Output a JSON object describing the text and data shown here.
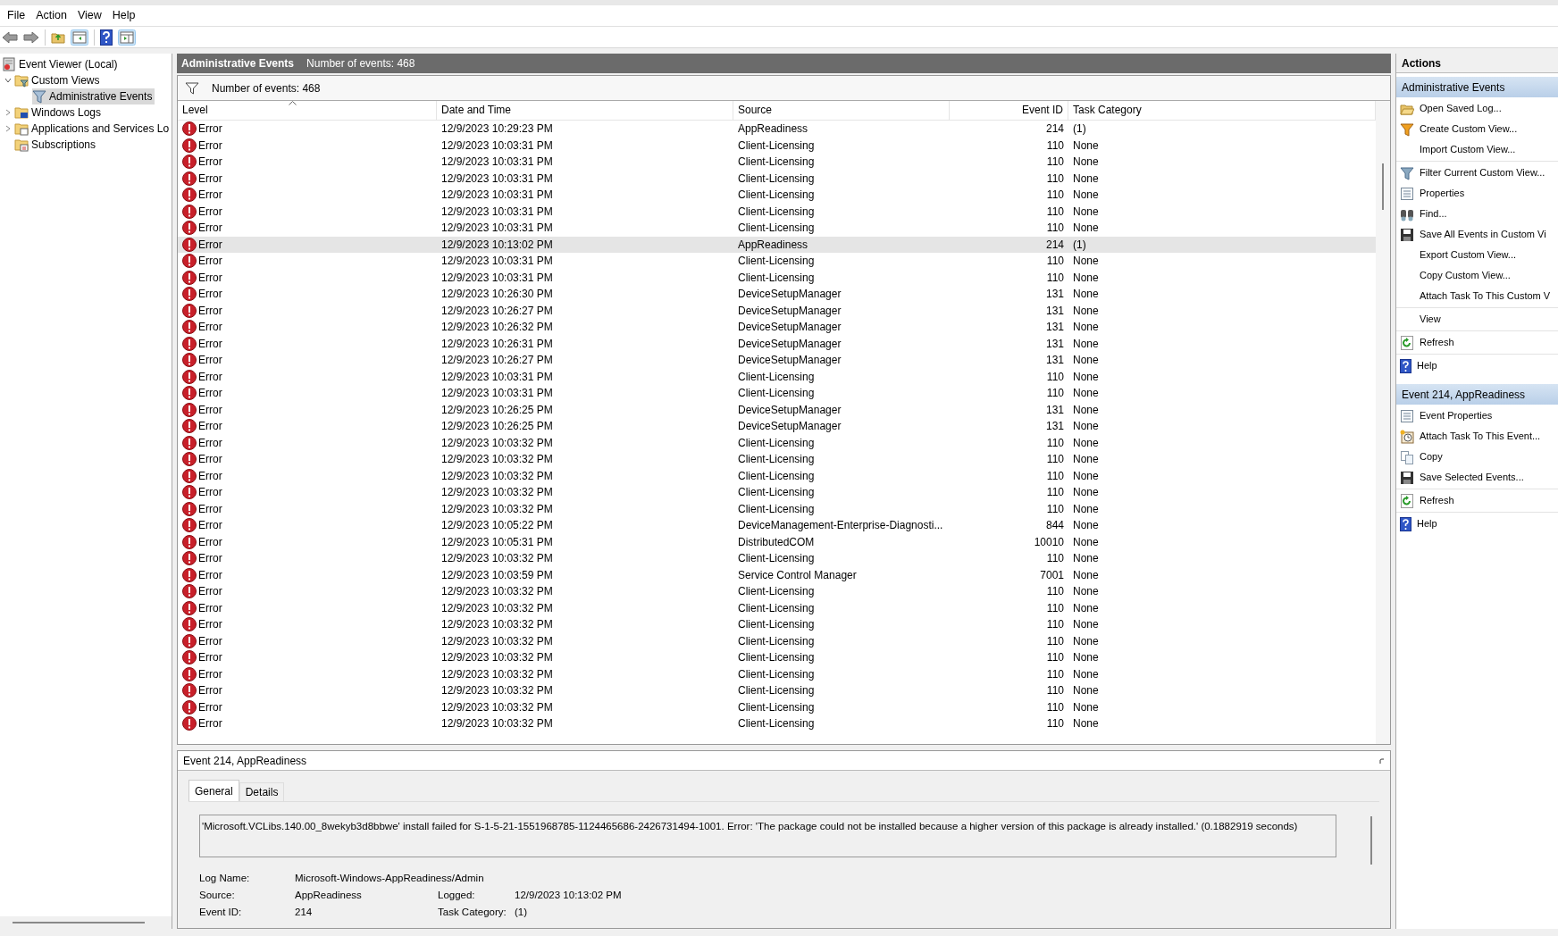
{
  "menu": [
    "File",
    "Action",
    "View",
    "Help"
  ],
  "tree": [
    {
      "label": "Event Viewer (Local)",
      "kind": "root",
      "selected": false,
      "children": [
        {
          "label": "Custom Views",
          "kind": "folder-filter",
          "expanded": true,
          "selected": false,
          "children": [
            {
              "label": "Administrative Events",
              "kind": "filter",
              "selected": true
            }
          ]
        },
        {
          "label": "Windows Logs",
          "kind": "folder-log",
          "expanded": false,
          "selected": false
        },
        {
          "label": "Applications and Services Lo",
          "kind": "folder-app",
          "expanded": false,
          "selected": false
        },
        {
          "label": "Subscriptions",
          "kind": "folder-sub",
          "selected": false
        }
      ]
    }
  ],
  "center": {
    "title": "Administrative Events",
    "count": "Number of events: 468",
    "filter_text": "Number of events: 468"
  },
  "table": {
    "columns": [
      "Level",
      "Date and Time",
      "Source",
      "Event ID",
      "Task Category"
    ],
    "rows": [
      {
        "level": "Error",
        "time": "12/9/2023 10:29:23 PM",
        "source": "AppReadiness",
        "id": "214",
        "category": "(1)",
        "selected": false
      },
      {
        "level": "Error",
        "time": "12/9/2023 10:03:31 PM",
        "source": "Client-Licensing",
        "id": "110",
        "category": "None",
        "selected": false
      },
      {
        "level": "Error",
        "time": "12/9/2023 10:03:31 PM",
        "source": "Client-Licensing",
        "id": "110",
        "category": "None",
        "selected": false
      },
      {
        "level": "Error",
        "time": "12/9/2023 10:03:31 PM",
        "source": "Client-Licensing",
        "id": "110",
        "category": "None",
        "selected": false
      },
      {
        "level": "Error",
        "time": "12/9/2023 10:03:31 PM",
        "source": "Client-Licensing",
        "id": "110",
        "category": "None",
        "selected": false
      },
      {
        "level": "Error",
        "time": "12/9/2023 10:03:31 PM",
        "source": "Client-Licensing",
        "id": "110",
        "category": "None",
        "selected": false
      },
      {
        "level": "Error",
        "time": "12/9/2023 10:03:31 PM",
        "source": "Client-Licensing",
        "id": "110",
        "category": "None",
        "selected": false
      },
      {
        "level": "Error",
        "time": "12/9/2023 10:13:02 PM",
        "source": "AppReadiness",
        "id": "214",
        "category": "(1)",
        "selected": true
      },
      {
        "level": "Error",
        "time": "12/9/2023 10:03:31 PM",
        "source": "Client-Licensing",
        "id": "110",
        "category": "None",
        "selected": false
      },
      {
        "level": "Error",
        "time": "12/9/2023 10:03:31 PM",
        "source": "Client-Licensing",
        "id": "110",
        "category": "None",
        "selected": false
      },
      {
        "level": "Error",
        "time": "12/9/2023 10:26:30 PM",
        "source": "DeviceSetupManager",
        "id": "131",
        "category": "None",
        "selected": false
      },
      {
        "level": "Error",
        "time": "12/9/2023 10:26:27 PM",
        "source": "DeviceSetupManager",
        "id": "131",
        "category": "None",
        "selected": false
      },
      {
        "level": "Error",
        "time": "12/9/2023 10:26:32 PM",
        "source": "DeviceSetupManager",
        "id": "131",
        "category": "None",
        "selected": false
      },
      {
        "level": "Error",
        "time": "12/9/2023 10:26:31 PM",
        "source": "DeviceSetupManager",
        "id": "131",
        "category": "None",
        "selected": false
      },
      {
        "level": "Error",
        "time": "12/9/2023 10:26:27 PM",
        "source": "DeviceSetupManager",
        "id": "131",
        "category": "None",
        "selected": false
      },
      {
        "level": "Error",
        "time": "12/9/2023 10:03:31 PM",
        "source": "Client-Licensing",
        "id": "110",
        "category": "None",
        "selected": false
      },
      {
        "level": "Error",
        "time": "12/9/2023 10:03:31 PM",
        "source": "Client-Licensing",
        "id": "110",
        "category": "None",
        "selected": false
      },
      {
        "level": "Error",
        "time": "12/9/2023 10:26:25 PM",
        "source": "DeviceSetupManager",
        "id": "131",
        "category": "None",
        "selected": false
      },
      {
        "level": "Error",
        "time": "12/9/2023 10:26:25 PM",
        "source": "DeviceSetupManager",
        "id": "131",
        "category": "None",
        "selected": false
      },
      {
        "level": "Error",
        "time": "12/9/2023 10:03:32 PM",
        "source": "Client-Licensing",
        "id": "110",
        "category": "None",
        "selected": false
      },
      {
        "level": "Error",
        "time": "12/9/2023 10:03:32 PM",
        "source": "Client-Licensing",
        "id": "110",
        "category": "None",
        "selected": false
      },
      {
        "level": "Error",
        "time": "12/9/2023 10:03:32 PM",
        "source": "Client-Licensing",
        "id": "110",
        "category": "None",
        "selected": false
      },
      {
        "level": "Error",
        "time": "12/9/2023 10:03:32 PM",
        "source": "Client-Licensing",
        "id": "110",
        "category": "None",
        "selected": false
      },
      {
        "level": "Error",
        "time": "12/9/2023 10:03:32 PM",
        "source": "Client-Licensing",
        "id": "110",
        "category": "None",
        "selected": false
      },
      {
        "level": "Error",
        "time": "12/9/2023 10:05:22 PM",
        "source": "DeviceManagement-Enterprise-Diagnosti...",
        "id": "844",
        "category": "None",
        "selected": false
      },
      {
        "level": "Error",
        "time": "12/9/2023 10:05:31 PM",
        "source": "DistributedCOM",
        "id": "10010",
        "category": "None",
        "selected": false
      },
      {
        "level": "Error",
        "time": "12/9/2023 10:03:32 PM",
        "source": "Client-Licensing",
        "id": "110",
        "category": "None",
        "selected": false
      },
      {
        "level": "Error",
        "time": "12/9/2023 10:03:59 PM",
        "source": "Service Control Manager",
        "id": "7001",
        "category": "None",
        "selected": false
      },
      {
        "level": "Error",
        "time": "12/9/2023 10:03:32 PM",
        "source": "Client-Licensing",
        "id": "110",
        "category": "None",
        "selected": false
      },
      {
        "level": "Error",
        "time": "12/9/2023 10:03:32 PM",
        "source": "Client-Licensing",
        "id": "110",
        "category": "None",
        "selected": false
      },
      {
        "level": "Error",
        "time": "12/9/2023 10:03:32 PM",
        "source": "Client-Licensing",
        "id": "110",
        "category": "None",
        "selected": false
      },
      {
        "level": "Error",
        "time": "12/9/2023 10:03:32 PM",
        "source": "Client-Licensing",
        "id": "110",
        "category": "None",
        "selected": false
      },
      {
        "level": "Error",
        "time": "12/9/2023 10:03:32 PM",
        "source": "Client-Licensing",
        "id": "110",
        "category": "None",
        "selected": false
      },
      {
        "level": "Error",
        "time": "12/9/2023 10:03:32 PM",
        "source": "Client-Licensing",
        "id": "110",
        "category": "None",
        "selected": false
      },
      {
        "level": "Error",
        "time": "12/9/2023 10:03:32 PM",
        "source": "Client-Licensing",
        "id": "110",
        "category": "None",
        "selected": false
      },
      {
        "level": "Error",
        "time": "12/9/2023 10:03:32 PM",
        "source": "Client-Licensing",
        "id": "110",
        "category": "None",
        "selected": false
      },
      {
        "level": "Error",
        "time": "12/9/2023 10:03:32 PM",
        "source": "Client-Licensing",
        "id": "110",
        "category": "None",
        "selected": false
      }
    ]
  },
  "details": {
    "title": "Event 214, AppReadiness",
    "tabs": [
      {
        "label": "General",
        "selected": true
      },
      {
        "label": "Details",
        "selected": false
      }
    ],
    "message": "'Microsoft.VCLibs.140.00_8wekyb3d8bbwe' install failed for S-1-5-21-1551968785-1124465686-2426731494-1001. Error: 'The package could not be installed because a higher version of this package is already installed.' (0.1882919 seconds)",
    "fields": [
      {
        "label": "Log Name:",
        "value": "Microsoft-Windows-AppReadiness/Admin"
      },
      {
        "label": "Source:",
        "value": "AppReadiness",
        "label2": "Logged:",
        "value2": "12/9/2023 10:13:02 PM"
      },
      {
        "label": "Event ID:",
        "value": "214",
        "label2": "Task Category:",
        "value2": "(1)"
      }
    ]
  },
  "actions": {
    "title": "Actions",
    "sections": [
      {
        "title": "Administrative Events",
        "groups": [
          [
            {
              "label": "Open Saved Log...",
              "kind": "folder"
            },
            {
              "label": "Create Custom View...",
              "kind": "funnel-new"
            },
            {
              "label": "Import Custom View...",
              "kind": "none"
            }
          ],
          [
            {
              "label": "Filter Current Custom View...",
              "kind": "funnel"
            },
            {
              "label": "Properties",
              "kind": "sheet"
            },
            {
              "label": "Find...",
              "kind": "binoculars"
            },
            {
              "label": "Save All Events in Custom Vi",
              "kind": "disk"
            },
            {
              "label": "Export Custom View...",
              "kind": "none"
            },
            {
              "label": "Copy Custom View...",
              "kind": "none"
            },
            {
              "label": "Attach Task To This Custom V",
              "kind": "none"
            }
          ],
          [
            {
              "label": "View",
              "kind": "none"
            }
          ],
          [
            {
              "label": "Refresh",
              "kind": "refresh"
            }
          ],
          [
            {
              "label": "Help",
              "kind": "help"
            }
          ]
        ]
      },
      {
        "title": "Event 214, AppReadiness",
        "groups": [
          [
            {
              "label": "Event Properties",
              "kind": "sheet"
            },
            {
              "label": "Attach Task To This Event...",
              "kind": "clock"
            },
            {
              "label": "Copy",
              "kind": "copy"
            },
            {
              "label": "Save Selected Events...",
              "kind": "disk"
            }
          ],
          [
            {
              "label": "Refresh",
              "kind": "refresh"
            }
          ],
          [
            {
              "label": "Help",
              "kind": "help"
            }
          ]
        ]
      }
    ]
  }
}
